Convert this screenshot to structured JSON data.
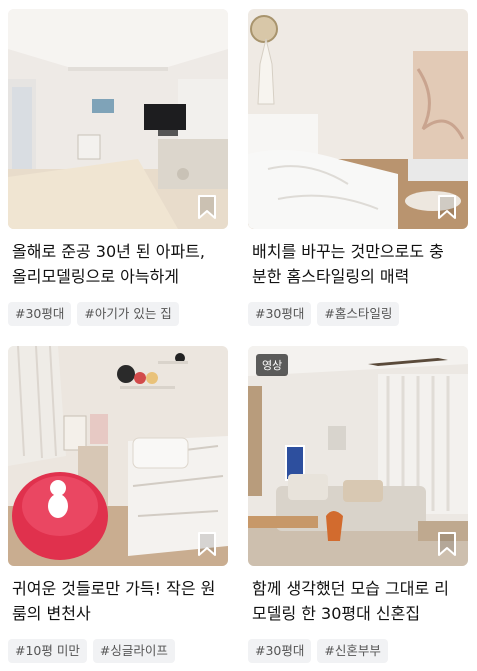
{
  "cards": [
    {
      "title": "올해로 준공 30년 된 아파트,\n올리모델링으로 아늑하게",
      "tags": [
        "#30평대",
        "#아기가 있는 집"
      ],
      "badge": ""
    },
    {
      "title": "배치를 바꾸는 것만으로도 충\n분한 홈스타일링의 매력",
      "tags": [
        "#30평대",
        "#홈스타일링"
      ],
      "badge": ""
    },
    {
      "title": "귀여운 것들로만 가득! 작은 원\n룸의 변천사",
      "tags": [
        "#10평 미만",
        "#싱글라이프"
      ],
      "badge": ""
    },
    {
      "title": "함께 생각했던 모습 그대로 리\n모델링 한 30평대 신혼집",
      "tags": [
        "#30평대",
        "#신혼부부"
      ],
      "badge": "영상"
    }
  ],
  "icons": {
    "bookmark": "bookmark-icon"
  }
}
